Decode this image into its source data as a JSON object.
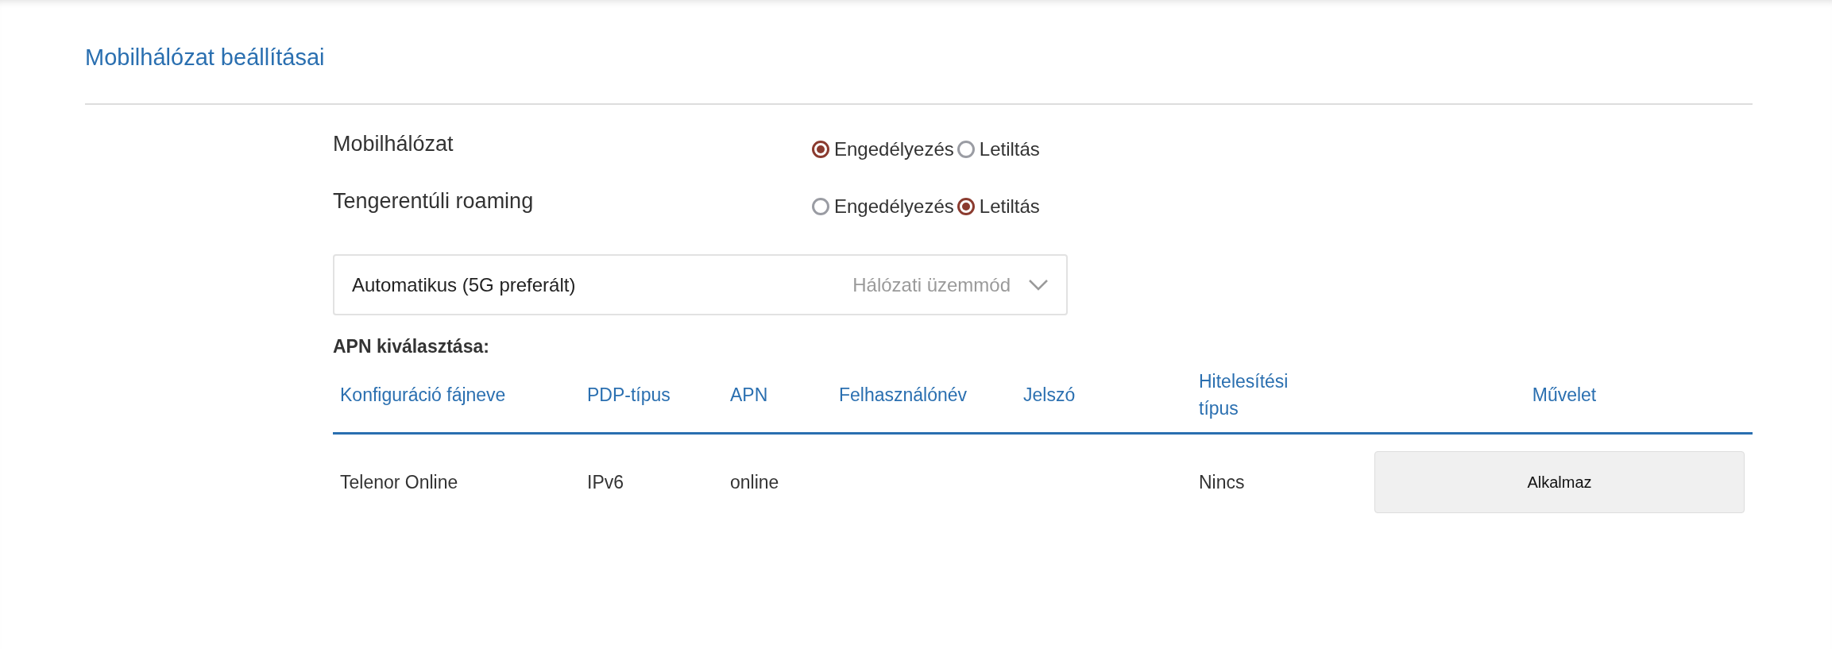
{
  "title": "Mobilhálózat beállításai",
  "settings": [
    {
      "label": "Mobilhálózat",
      "options": [
        {
          "label": "Engedélyezés",
          "selected": true
        },
        {
          "label": "Letiltás",
          "selected": false
        }
      ]
    },
    {
      "label": "Tengerentúli roaming",
      "options": [
        {
          "label": "Engedélyezés",
          "selected": false
        },
        {
          "label": "Letiltás",
          "selected": true
        }
      ]
    }
  ],
  "network_mode": {
    "value": "Automatikus (5G preferált)",
    "label": "Hálózati üzemmód"
  },
  "apn_heading": "APN kiválasztása:",
  "apn_table": {
    "columns": [
      "Konfiguráció fájneve",
      "PDP-típus",
      "APN",
      "Felhasználónév",
      "Jelszó",
      "Hitelesítési típus",
      "Művelet"
    ],
    "rows": [
      {
        "config_name": "Telenor Online",
        "pdp_type": "IPv6",
        "apn": "online",
        "auth_type": "Nincs",
        "action": "Alkalmaz"
      }
    ]
  }
}
